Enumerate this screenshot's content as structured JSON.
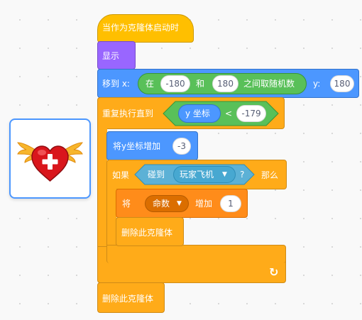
{
  "sprite": {
    "icon": "winged-heart-icon"
  },
  "script": {
    "hat": {
      "label": "当作为克隆体启动时"
    },
    "show": {
      "label": "显示"
    },
    "goto": {
      "label": "移到 x:",
      "random": {
        "prefix": "在",
        "from": "-180",
        "and": "和",
        "to": "180",
        "suffix": "之间取随机数"
      },
      "y_label": "y:",
      "y_value": "180"
    },
    "repeat_until": {
      "label": "重复执行直到",
      "condition": {
        "reporter": "y 坐标",
        "operator": "<",
        "value": "-179"
      }
    },
    "change_y": {
      "label": "将y坐标增加",
      "value": "-3"
    },
    "if": {
      "label": "如果",
      "touching": {
        "label": "碰到",
        "target": "玩家飞机",
        "suffix": "?"
      },
      "then": "那么"
    },
    "change_var": {
      "prefix": "将",
      "variable": "命数",
      "by": "增加",
      "value": "1"
    },
    "delete_inner": {
      "label": "删除此克隆体"
    },
    "delete_outer": {
      "label": "删除此克隆体"
    },
    "loop_arrow": "↻"
  }
}
